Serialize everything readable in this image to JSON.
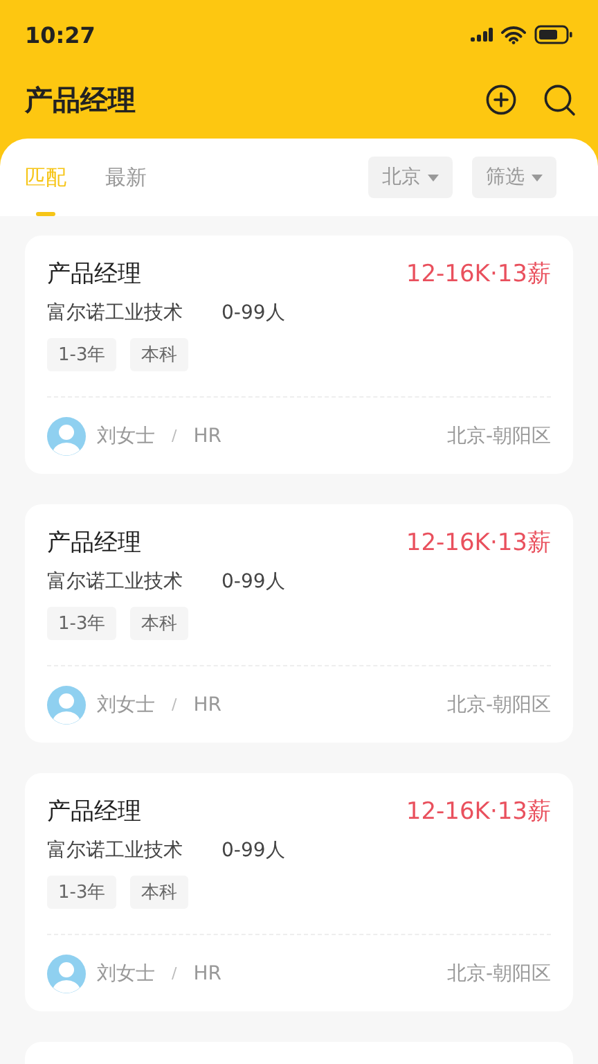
{
  "status_bar": {
    "time": "10:27"
  },
  "header": {
    "title": "产品经理"
  },
  "tabs": [
    {
      "label": "匹配",
      "selected": true
    },
    {
      "label": "最新",
      "selected": false
    }
  ],
  "filters": [
    {
      "label": "北京"
    },
    {
      "label": "筛选"
    }
  ],
  "jobs": [
    {
      "title": "产品经理",
      "salary": "12-16K·13薪",
      "company": "富尔诺工业技术",
      "size": "0-99人",
      "tags": [
        "1-3年",
        "本科"
      ],
      "recruiter": "刘女士",
      "separator": "/",
      "role": "HR",
      "location": "北京-朝阳区"
    },
    {
      "title": "产品经理",
      "salary": "12-16K·13薪",
      "company": "富尔诺工业技术",
      "size": "0-99人",
      "tags": [
        "1-3年",
        "本科"
      ],
      "recruiter": "刘女士",
      "separator": "/",
      "role": "HR",
      "location": "北京-朝阳区"
    },
    {
      "title": "产品经理",
      "salary": "12-16K·13薪",
      "company": "富尔诺工业技术",
      "size": "0-99人",
      "tags": [
        "1-3年",
        "本科"
      ],
      "recruiter": "刘女士",
      "separator": "/",
      "role": "HR",
      "location": "北京-朝阳区"
    }
  ]
}
